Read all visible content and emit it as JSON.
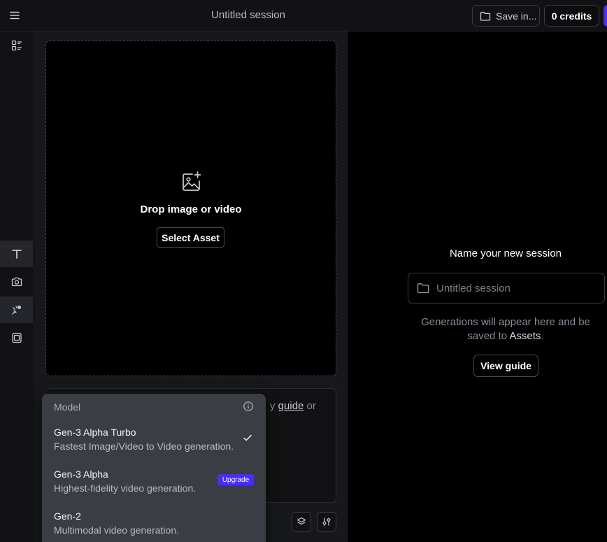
{
  "header": {
    "session_title": "Untitled session",
    "save_label": "Save in...",
    "credits_label": "0 credits"
  },
  "rail": {
    "items": [
      {
        "icon": "layout-icon"
      },
      {
        "icon": "text-icon"
      },
      {
        "icon": "camera-icon"
      },
      {
        "icon": "motion-brush-icon"
      },
      {
        "icon": "frames-icon"
      }
    ]
  },
  "upload": {
    "title": "Drop image or video",
    "select_label": "Select Asset"
  },
  "prompt": {
    "partial_prefix": "y ",
    "guide_link": "guide",
    "partial_suffix": " or"
  },
  "model_menu": {
    "header": "Model",
    "options": [
      {
        "name": "Gen-3 Alpha Turbo",
        "description": "Fastest Image/Video to Video generation.",
        "selected": true
      },
      {
        "name": "Gen-3 Alpha",
        "description": "Highest-fidelity video generation.",
        "badge": "Upgrade"
      },
      {
        "name": "Gen-2",
        "description": "Multimodal video generation."
      }
    ]
  },
  "session_panel": {
    "label": "Name your new session",
    "input_placeholder": "Untitled session",
    "generations_text": "Generations will appear here and be saved to ",
    "assets_word": "Assets",
    "period": ".",
    "view_guide_label": "View guide"
  },
  "colors": {
    "accent": "#4c2bff",
    "background": "#000000",
    "panel": "#17181b",
    "dropdown": "#3b3d45"
  }
}
